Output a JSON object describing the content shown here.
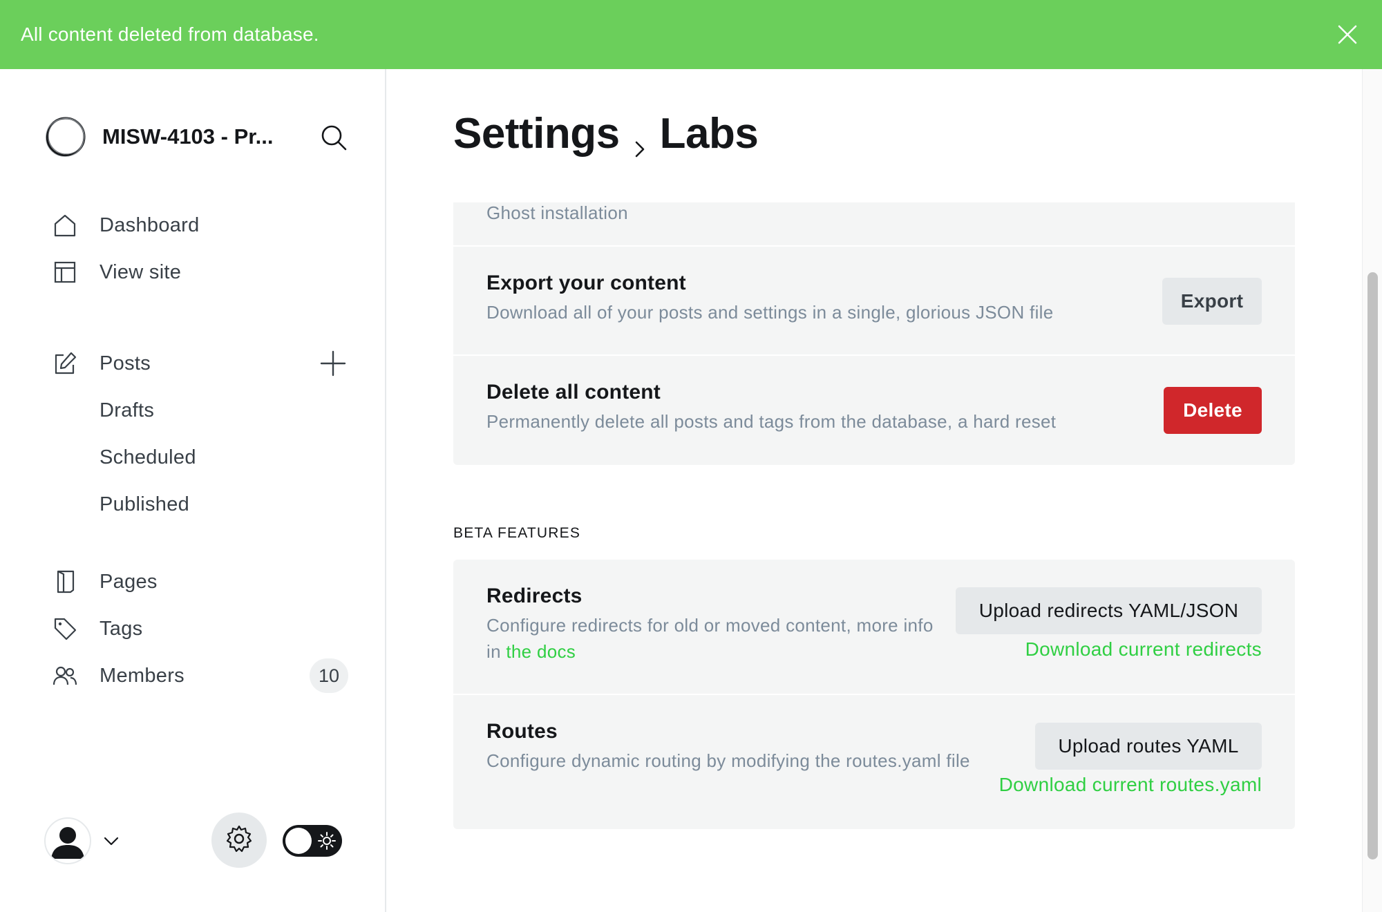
{
  "banner": {
    "message": "All content deleted from database."
  },
  "sidebar": {
    "site_title": "MISW-4103 - Pr...",
    "nav": [
      {
        "label": "Dashboard",
        "icon": "home-icon"
      },
      {
        "label": "View site",
        "icon": "layout-icon"
      }
    ],
    "posts": {
      "label": "Posts",
      "sub": [
        "Drafts",
        "Scheduled",
        "Published"
      ]
    },
    "nav2": [
      {
        "label": "Pages",
        "icon": "pages-icon"
      },
      {
        "label": "Tags",
        "icon": "tag-icon"
      },
      {
        "label": "Members",
        "icon": "members-icon",
        "count": "10"
      }
    ]
  },
  "header": {
    "crumb_parent": "Settings",
    "crumb_current": "Labs"
  },
  "migration": {
    "partial_text": "Ghost installation",
    "export": {
      "title": "Export your content",
      "desc": "Download all of your posts and settings in a single, glorious JSON file",
      "button": "Export"
    },
    "delete": {
      "title": "Delete all content",
      "desc": "Permanently delete all posts and tags from the database, a hard reset",
      "button": "Delete"
    }
  },
  "beta": {
    "label": "BETA FEATURES",
    "redirects": {
      "title": "Redirects",
      "desc_prefix": "Configure redirects for old or moved content, more info in ",
      "desc_link": "the docs",
      "button": "Upload redirects YAML/JSON",
      "download": "Download current redirects"
    },
    "routes": {
      "title": "Routes",
      "desc": "Configure dynamic routing by modifying the routes.yaml file",
      "button": "Upload routes YAML",
      "download": "Download current routes.yaml"
    }
  },
  "colors": {
    "banner_green": "#6bcf5b",
    "link_green": "#30cf43",
    "danger_red": "#d0272b"
  }
}
